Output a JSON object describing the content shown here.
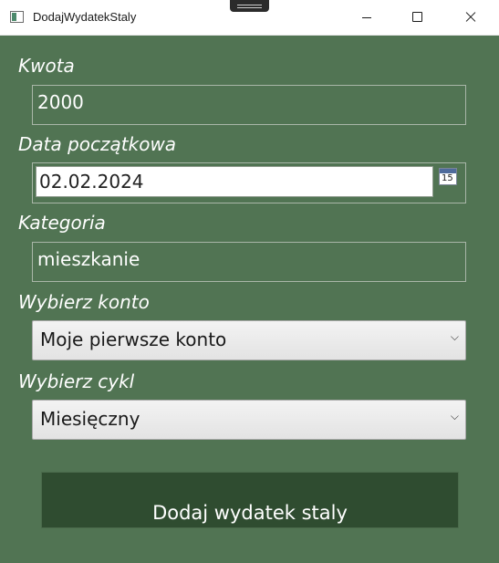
{
  "window": {
    "title": "DodajWydatekStaly"
  },
  "form": {
    "amount_label": "Kwota",
    "amount_value": "2000",
    "start_date_label": "Data początkowa",
    "start_date_value": "02.02.2024",
    "calendar_day": "15",
    "category_label": "Kategoria",
    "category_value": "mieszkanie",
    "account_label": "Wybierz konto",
    "account_selected": "Moje pierwsze konto",
    "cycle_label": "Wybierz cykl",
    "cycle_selected": "Miesięczny",
    "chevron_icon": "chevron-down",
    "submit_label": "Dodaj wydatek staly"
  },
  "colors": {
    "window_background": "#517453",
    "button_background": "#2f4c30",
    "label_text": "#ffffff"
  }
}
